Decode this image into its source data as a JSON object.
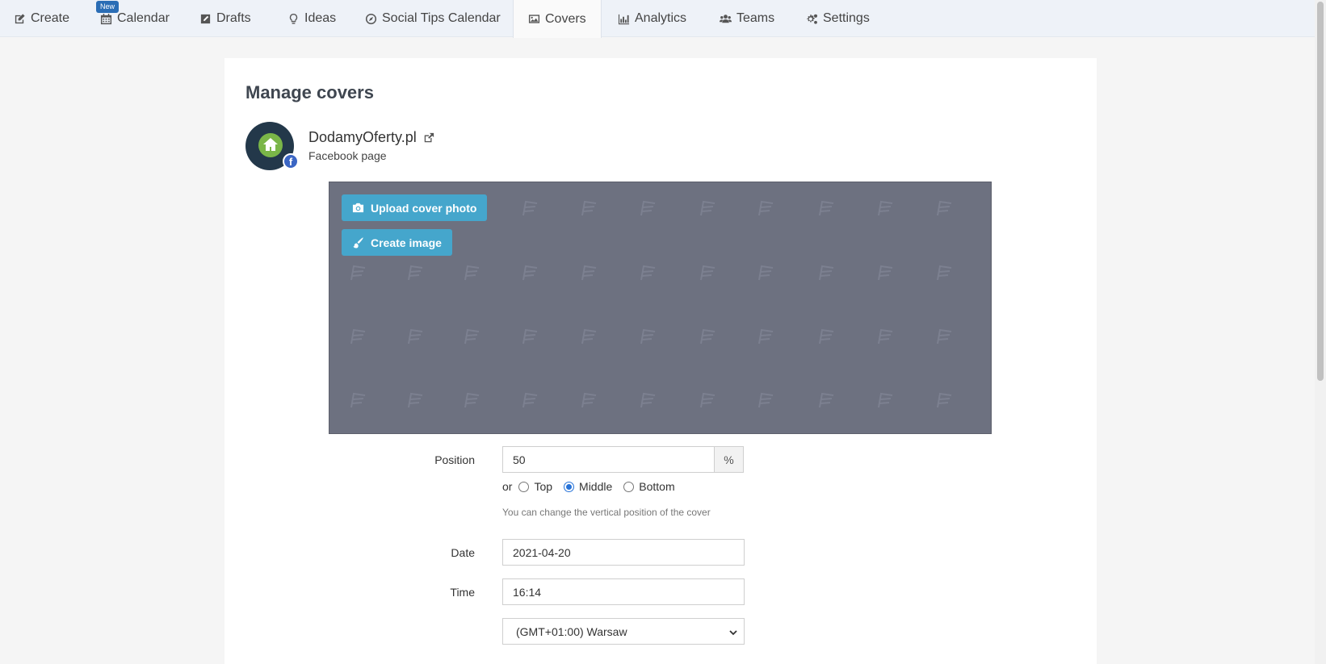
{
  "nav": {
    "items": [
      {
        "label": "Create",
        "icon": "edit-icon"
      },
      {
        "label": "Calendar",
        "icon": "calendar-icon"
      },
      {
        "label": "Drafts",
        "icon": "pencil-square-icon"
      },
      {
        "label": "Ideas",
        "icon": "lightbulb-icon"
      },
      {
        "label": "Social Tips Calendar",
        "icon": "compass-icon"
      },
      {
        "label": "Covers",
        "icon": "image-icon"
      },
      {
        "label": "Analytics",
        "icon": "bar-chart-icon"
      },
      {
        "label": "Teams",
        "icon": "users-icon"
      },
      {
        "label": "Settings",
        "icon": "cogs-icon"
      }
    ],
    "active": "Covers",
    "new_badge": "New"
  },
  "page": {
    "title": "Manage covers"
  },
  "account": {
    "name": "DodamyOferty.pl",
    "type": "Facebook page",
    "fb_badge": "f"
  },
  "cover": {
    "upload_label": "Upload cover photo",
    "create_label": "Create image",
    "background_color": "#6d7180",
    "button_color": "#45a6cc"
  },
  "form": {
    "position_label": "Position",
    "position_value": "50",
    "position_unit": "%",
    "or_label": "or",
    "radio_options": [
      "Top",
      "Middle",
      "Bottom"
    ],
    "radio_selected": "Middle",
    "hint": "You can change the vertical position of the cover",
    "date_label": "Date",
    "date_value": "2021-04-20",
    "time_label": "Time",
    "time_value": "16:14",
    "timezone_value": "(GMT+01:00) Warsaw"
  }
}
